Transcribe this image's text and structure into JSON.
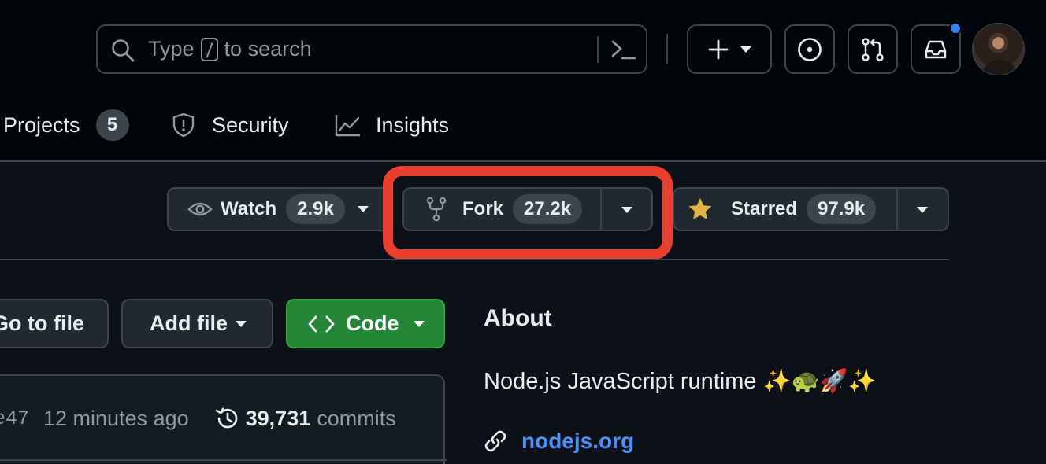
{
  "header": {
    "search": {
      "placeholder_pre": "Type",
      "placeholder_key": "/",
      "placeholder_post": "to search"
    },
    "icons": [
      "search-icon",
      "command-palette-icon",
      "plus-icon",
      "issues-icon",
      "pull-requests-icon",
      "inbox-icon"
    ],
    "notification_color": "#2f81f7"
  },
  "tabs": {
    "projects": {
      "label": "Projects",
      "count": "5"
    },
    "security": {
      "label": "Security"
    },
    "insights": {
      "label": "Insights"
    }
  },
  "repo_actions": {
    "watch": {
      "label": "Watch",
      "count": "2.9k"
    },
    "fork": {
      "label": "Fork",
      "count": "27.2k"
    },
    "star": {
      "label": "Starred",
      "count": "97.9k",
      "icon_color": "#e3b341"
    },
    "highlight_color": "#e8402c"
  },
  "file_actions": {
    "goto_file": "Go to file",
    "add_file": "Add file",
    "code": "Code",
    "code_color": "#238636"
  },
  "latest_commit": {
    "hash_fragment": "e47",
    "time": "12 minutes ago",
    "commit_count": "39,731",
    "commits_label": "commits"
  },
  "about": {
    "title": "About",
    "description": "Node.js JavaScript runtime ✨🐢🚀✨",
    "website": "nodejs.org"
  }
}
